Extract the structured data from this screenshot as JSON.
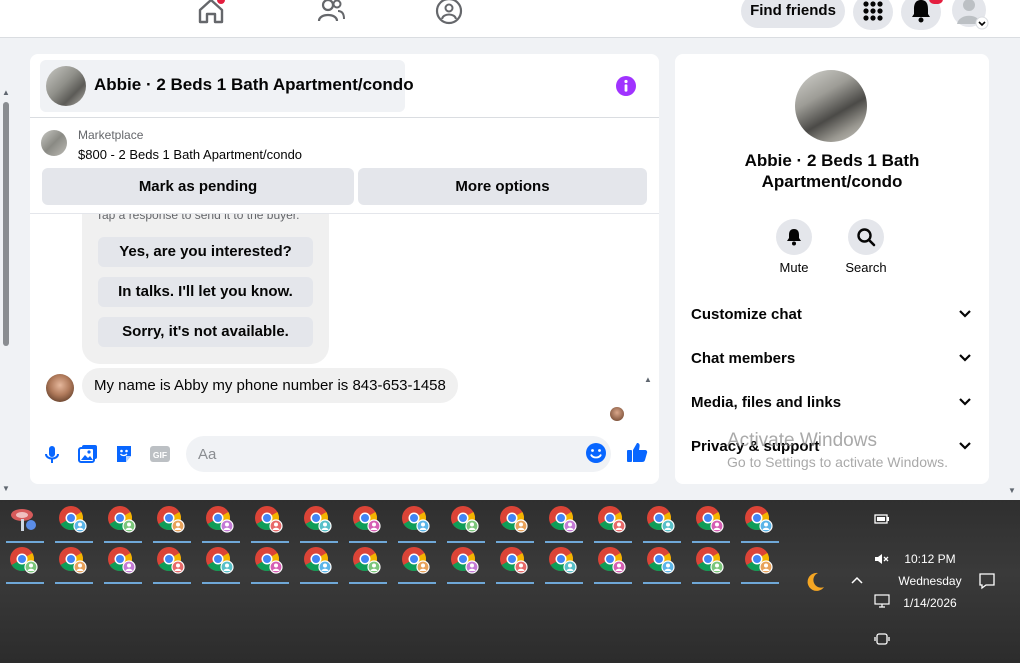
{
  "nav": {
    "find_friends_label": "Find friends"
  },
  "chat": {
    "title": "Abbie · 2 Beds 1 Bath Apartment/condo",
    "listing": {
      "source": "Marketplace",
      "description": "$800 - 2 Beds 1 Bath Apartment/condo",
      "mark_pending_label": "Mark as pending",
      "more_options_label": "More options"
    },
    "quick_replies": {
      "hint": "Tap a response to send it to the buyer.",
      "options": [
        "Yes, are you interested?",
        "In talks. I'll let you know.",
        "Sorry, it's not available."
      ]
    },
    "message": "My name is Abby my phone number is 843-653-1458",
    "composer": {
      "placeholder": "Aa"
    }
  },
  "info_panel": {
    "title": "Abbie · 2 Beds 1 Bath Apartment/condo",
    "mute_label": "Mute",
    "search_label": "Search",
    "sections": [
      "Customize chat",
      "Chat members",
      "Media, files and links",
      "Privacy & support"
    ]
  },
  "watermark": {
    "line1": "Activate Windows",
    "line2": "Go to Settings to activate Windows."
  },
  "tray": {
    "time": "10:12 PM",
    "day": "Wednesday",
    "date": "1/14/2026"
  },
  "colors": {
    "messenger_purple": "#a033ff",
    "facebook_blue": "#0866ff",
    "notification_red": "#e41e3f"
  }
}
